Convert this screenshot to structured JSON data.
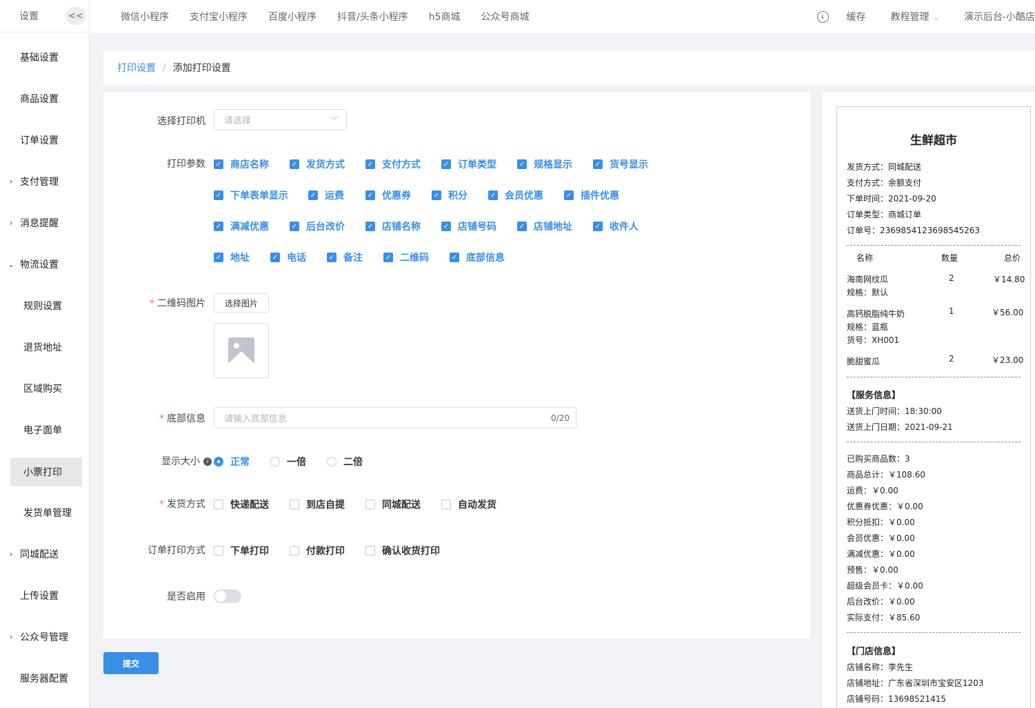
{
  "sidebar": {
    "title": "设置",
    "collapse_label": "<<",
    "items": [
      {
        "label": "基础设置"
      },
      {
        "label": "商品设置"
      },
      {
        "label": "订单设置"
      },
      {
        "label": "支付管理",
        "arrow": "›"
      },
      {
        "label": "消息提醒",
        "arrow": "›"
      },
      {
        "label": "物流设置",
        "arrow": "⌄"
      },
      {
        "label": "规则设置"
      },
      {
        "label": "退货地址"
      },
      {
        "label": "区域购买"
      },
      {
        "label": "电子面单"
      },
      {
        "label": "小票打印"
      },
      {
        "label": "发货单管理"
      },
      {
        "label": "同城配送",
        "arrow": "›"
      },
      {
        "label": "上传设置"
      },
      {
        "label": "公众号管理",
        "arrow": "›"
      },
      {
        "label": "服务器配置"
      }
    ]
  },
  "topnav": {
    "items": [
      "微信小程序",
      "支付宝小程序",
      "百度小程序",
      "抖音/头条小程序",
      "h5商城",
      "公众号商城"
    ],
    "cache": "缓存",
    "tutorial": "教程管理",
    "caret": "⌄",
    "account": "演示后台-小酷店"
  },
  "breadcrumb": {
    "parent": "打印设置",
    "separator": "/",
    "current": "添加打印设置"
  },
  "form": {
    "printer_label": "选择打印机",
    "printer_placeholder": "请选择",
    "params_label": "打印参数",
    "params": [
      [
        "商店名称",
        "发货方式",
        "支付方式",
        "订单类型",
        "规格显示",
        "货号显示"
      ],
      [
        "下单表单显示",
        "运费",
        "优惠券",
        "积分",
        "会员优惠",
        "插件优惠"
      ],
      [
        "满减优惠",
        "后台改价",
        "店铺名称",
        "店铺号码",
        "店铺地址",
        "收件人"
      ],
      [
        "地址",
        "电话",
        "备注",
        "二维码",
        "底部信息"
      ]
    ],
    "qrcode_label": "二维码图片",
    "choose_image": "选择图片",
    "footer_label": "底部信息",
    "footer_placeholder": "请输入底部信息",
    "footer_count": "0/20",
    "size_label": "显示大小",
    "size_options": [
      "正常",
      "一倍",
      "二倍"
    ],
    "size_selected": "正常",
    "delivery_label": "发货方式",
    "delivery_options": [
      "快递配送",
      "到店自提",
      "同城配送",
      "自动发货"
    ],
    "print_mode_label": "订单打印方式",
    "print_mode_options": [
      "下单打印",
      "付款打印",
      "确认收货打印"
    ],
    "enable_label": "是否启用",
    "enabled": false,
    "required_mark": "*",
    "submit": "提交"
  },
  "receipt": {
    "title": "生鲜超市",
    "info": [
      "发货方式：同城配送",
      "支付方式：余额支付",
      "下单时间：2021-09-20",
      "订单类型：商城订单",
      "订单号：2369854123698545263"
    ],
    "columns": [
      "名称",
      "数量",
      "总价"
    ],
    "products": [
      {
        "name": "海南网纹瓜",
        "qty": "2",
        "price": "￥14.80",
        "spec": "规格：默认"
      },
      {
        "name": "高钙脱脂纯牛奶",
        "qty": "1",
        "price": "￥56.00",
        "spec": "规格：蓝瓶",
        "sku": "货号：XH001"
      },
      {
        "name": "脆甜蜜瓜",
        "qty": "2",
        "price": "￥23.00"
      }
    ],
    "service_title": "【服务信息】",
    "service": [
      "送货上门时间：18:30:00",
      "送货上门日期：2021-09-21"
    ],
    "summary": [
      "已购买商品数：3",
      "商品总计：￥108.60",
      "运费：￥0.00",
      "优惠券优惠：￥0.00",
      "积分抵扣：￥0.00",
      "会员优惠：￥0.00",
      "满减优惠：￥0.00",
      "预售：￥0.00",
      "超级会员卡：￥0.00",
      "后台改价：￥0.00",
      "实际支付：￥85.60"
    ],
    "store_title": "【门店信息】",
    "store": [
      "店铺名称：李先生",
      "店铺地址：广东省深圳市宝安区1203",
      "店铺号码：13698521415"
    ]
  },
  "colors": {
    "accent": "#3a8ee6",
    "required": "#f56c6c",
    "background": "#f0f2f5"
  }
}
